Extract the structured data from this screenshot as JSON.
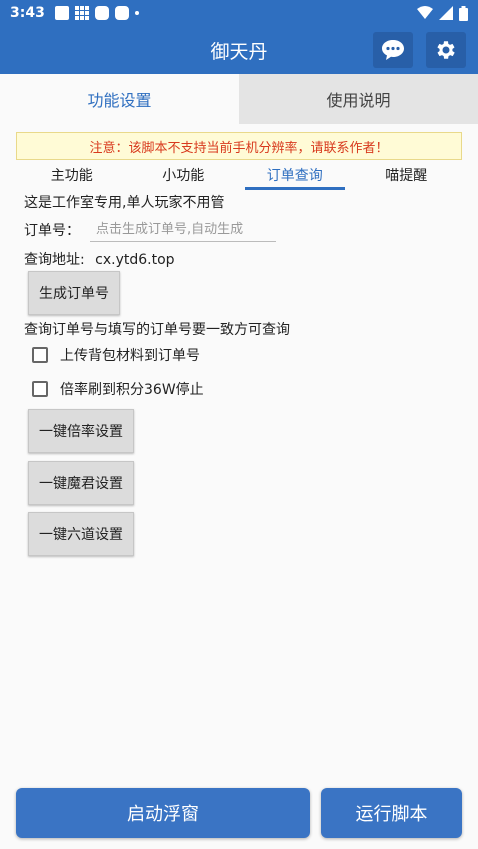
{
  "statusbar": {
    "time": "3:43"
  },
  "appbar": {
    "title": "御天丹"
  },
  "tabs": [
    {
      "label": "功能设置"
    },
    {
      "label": "使用说明"
    }
  ],
  "notice": "注意：该脚本不支持当前手机分辨率，请联系作者！",
  "subtabs": [
    {
      "label": "主功能"
    },
    {
      "label": "小功能"
    },
    {
      "label": "订单查询"
    },
    {
      "label": "喵提醒"
    }
  ],
  "content": {
    "studio_note": "这是工作室专用,单人玩家不用管",
    "order_label": "订单号：",
    "order_placeholder": "点击生成订单号,自动生成",
    "query_label": "查询地址:",
    "query_url": "cx.ytd6.top",
    "generate_button": "生成订单号",
    "query_note": "查询订单号与填写的订单号要一致方可查询",
    "checkbox_upload": "上传背包材料到订单号",
    "checkbox_stop": "倍率刷到积分36W停止",
    "btn_rate": "一键倍率设置",
    "btn_mojun": "一键魔君设置",
    "btn_liudao": "一键六道设置"
  },
  "bottom": {
    "float_button": "启动浮窗",
    "run_button": "运行脚本"
  }
}
